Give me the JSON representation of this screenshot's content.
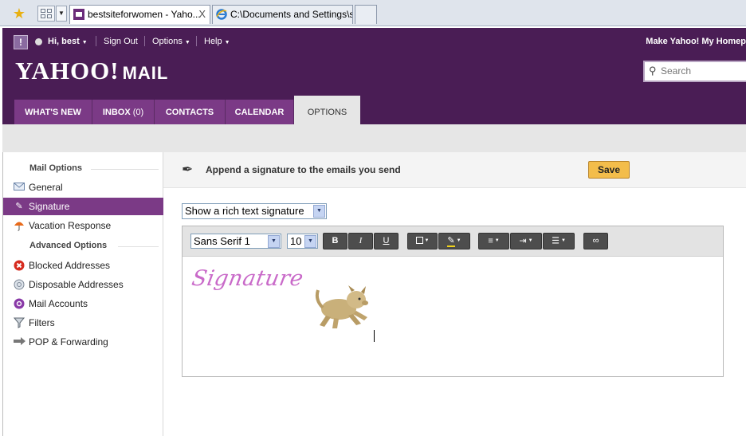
{
  "browser": {
    "tabs": [
      {
        "title": "bestsiteforwomen - Yaho...",
        "close": "X"
      },
      {
        "title": "C:\\Documents and Settings\\s..."
      }
    ]
  },
  "header": {
    "greeting": "Hi, best",
    "links": [
      "Sign Out",
      "Options",
      "Help"
    ],
    "make_home": "Make Yahoo! My Homep",
    "brand": "YAHOO!",
    "brand_mail": "MAIL",
    "search_placeholder": "Search",
    "nav": [
      {
        "label": "WHAT'S NEW"
      },
      {
        "label": "INBOX",
        "count": "(0)"
      },
      {
        "label": "CONTACTS"
      },
      {
        "label": "CALENDAR"
      },
      {
        "label": "OPTIONS"
      }
    ]
  },
  "sidebar": {
    "mail_options_heading": "Mail Options",
    "advanced_heading": "Advanced Options",
    "items": [
      {
        "label": "General",
        "icon": "envelope-icon"
      },
      {
        "label": "Signature",
        "icon": "pen-icon",
        "selected": true
      },
      {
        "label": "Vacation Response",
        "icon": "umbrella-icon"
      },
      {
        "label": "Blocked Addresses",
        "icon": "block-icon"
      },
      {
        "label": "Disposable Addresses",
        "icon": "disposable-icon"
      },
      {
        "label": "Mail Accounts",
        "icon": "at-icon"
      },
      {
        "label": "Filters",
        "icon": "filter-icon"
      },
      {
        "label": "POP & Forwarding",
        "icon": "arrow-right-icon"
      }
    ]
  },
  "main": {
    "title": "Append a signature to the emails you send",
    "save_label": "Save",
    "signature_mode": "Show a rich text signature",
    "editor": {
      "font": "Sans Serif 1",
      "size": "10",
      "bold": "B",
      "italic": "I",
      "underline": "U",
      "signature_text": "Signature"
    }
  },
  "colors": {
    "brand_purple": "#4a1d55",
    "tab_purple": "#7b3a86",
    "save_button": "#f3bd4b",
    "signature_pink": "#c96ac9"
  }
}
